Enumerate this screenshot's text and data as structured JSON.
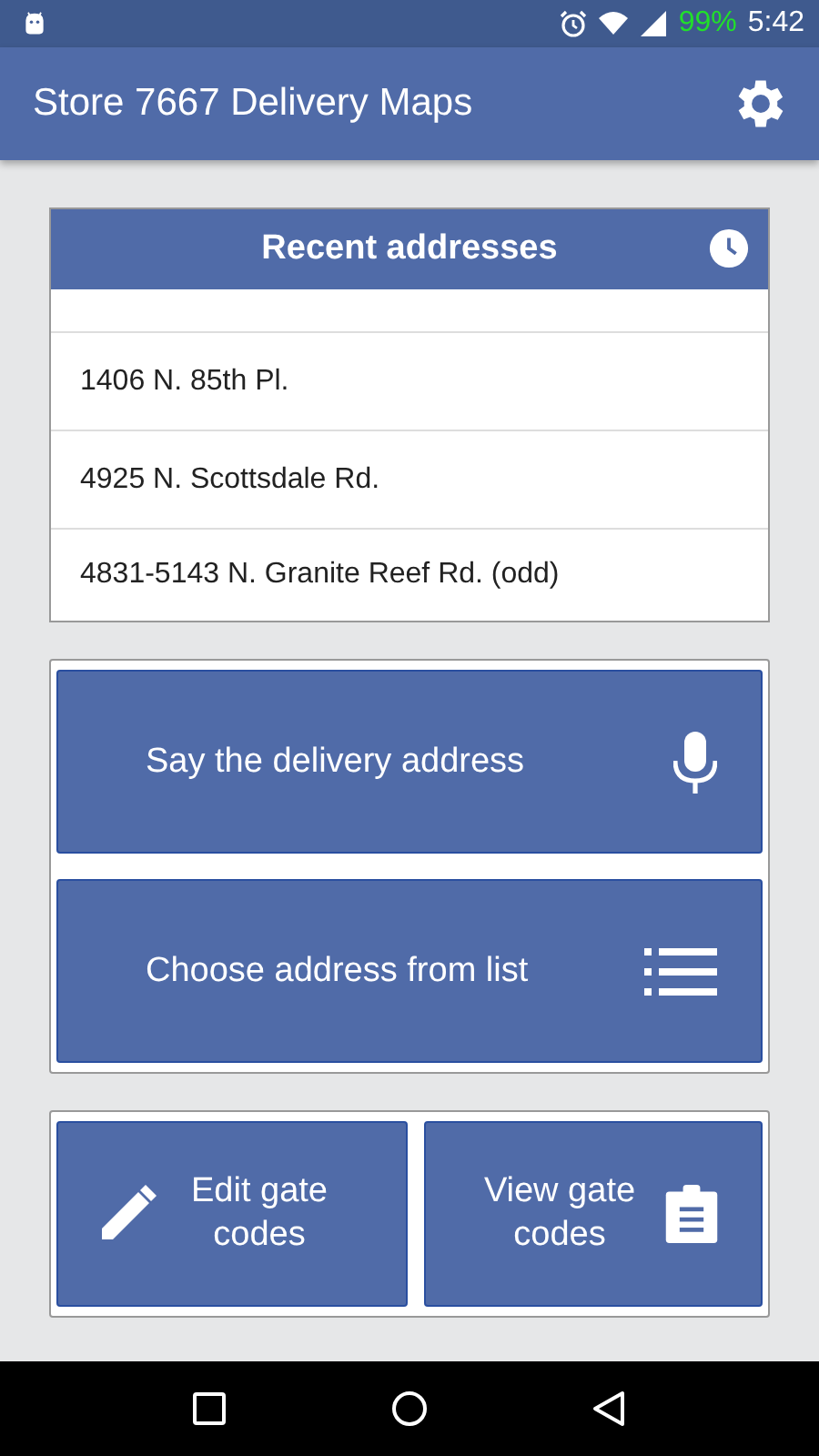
{
  "status_bar": {
    "battery": "99%",
    "time": "5:42"
  },
  "app_bar": {
    "title": "Store 7667 Delivery Maps"
  },
  "recent": {
    "title": "Recent addresses",
    "items": [
      "1406 N. 85th Pl.",
      "4925 N. Scottsdale Rd.",
      "4831-5143 N. Granite Reef Rd. (odd)"
    ]
  },
  "actions": [
    {
      "label": "Say the delivery address",
      "kind": "mic"
    },
    {
      "label": "Choose address from list",
      "kind": "list"
    }
  ],
  "gate_buttons": [
    {
      "label": "Edit gate codes",
      "kind": "edit"
    },
    {
      "label": "View gate codes",
      "kind": "clipboard"
    }
  ]
}
